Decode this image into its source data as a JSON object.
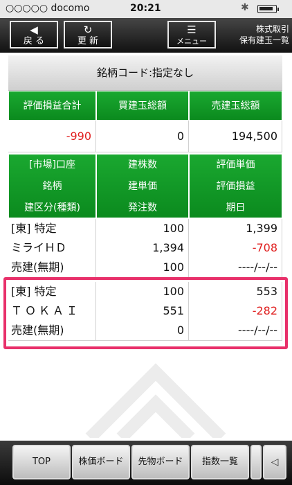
{
  "status_bar": {
    "carrier": "○○○○○ docomo",
    "time": "20:21",
    "bluetooth": "✱"
  },
  "toolbar": {
    "back_label": "戻 る",
    "refresh_label": "更 新",
    "menu_label": "メニュー",
    "title_line1": "株式取引",
    "title_line2": "保有建玉一覧"
  },
  "filter": {
    "code_label": "銘柄コード:指定なし"
  },
  "summary": {
    "headers": [
      "評価損益合計",
      "買建玉総額",
      "売建玉総額"
    ],
    "values": [
      "-990",
      "0",
      "194,500"
    ]
  },
  "columns": {
    "col1": [
      "[市場]口座",
      "銘柄",
      "建区分(種類)"
    ],
    "col2": [
      "建株数",
      "建単価",
      "発注数"
    ],
    "col3": [
      "評価単価",
      "評価損益",
      "期日"
    ]
  },
  "positions": [
    {
      "market_account": "[東] 特定",
      "name": "ミライＨＤ",
      "type": "売建(無期)",
      "shares": "100",
      "unit_price": "1,394",
      "order_qty": "100",
      "eval_price": "1,399",
      "eval_pl": "-708",
      "due": "----/--/--"
    },
    {
      "market_account": "[東] 特定",
      "name": "ＴＯＫＡＩ",
      "type": "売建(無期)",
      "shares": "100",
      "unit_price": "551",
      "order_qty": "0",
      "eval_price": "553",
      "eval_pl": "-282",
      "due": "----/--/--"
    }
  ],
  "bottom_nav": {
    "items": [
      "TOP",
      "株価ボード",
      "先物ボード",
      "指数一覧"
    ],
    "arrow": "◁"
  },
  "colors": {
    "header_green": "#0f9a25",
    "negative_red": "#e02020",
    "highlight_pink": "#e8306a"
  }
}
